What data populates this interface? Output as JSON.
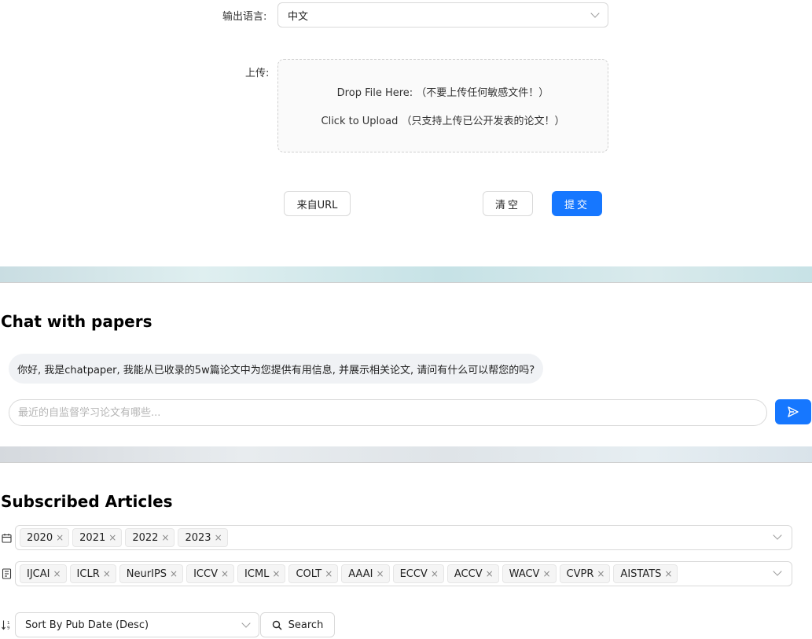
{
  "paper_form": {
    "lang_label": "输出语言:",
    "lang_value": "中文",
    "upload_label": "上传:",
    "upload_line1": "Drop File Here: （不要上传任何敏感文件！）",
    "upload_line2": "Click to Upload （只支持上传已公开发表的论文！）",
    "from_url_label": "来自URL",
    "clear_label": "清空",
    "submit_label": "提交"
  },
  "chat": {
    "title": "Chat with papers",
    "greeting": "你好, 我是chatpaper, 我能从已收录的5w篇论文中为您提供有用信息, 并展示相关论文, 请问有什么可以帮您的吗?",
    "input_placeholder": "最近的自监督学习论文有哪些..."
  },
  "subscribed": {
    "title": "Subscribed Articles",
    "years": [
      "2020",
      "2021",
      "2022",
      "2023"
    ],
    "venues": [
      "IJCAI",
      "ICLR",
      "NeurIPS",
      "ICCV",
      "ICML",
      "COLT",
      "AAAI",
      "ECCV",
      "ACCV",
      "WACV",
      "CVPR",
      "AISTATS"
    ],
    "sort_value": "Sort By Pub Date (Desc)",
    "search_label": "Search"
  },
  "colors": {
    "primary": "#1677ff",
    "border": "#d9d9d9",
    "tag_bg": "#f5f5f5"
  }
}
